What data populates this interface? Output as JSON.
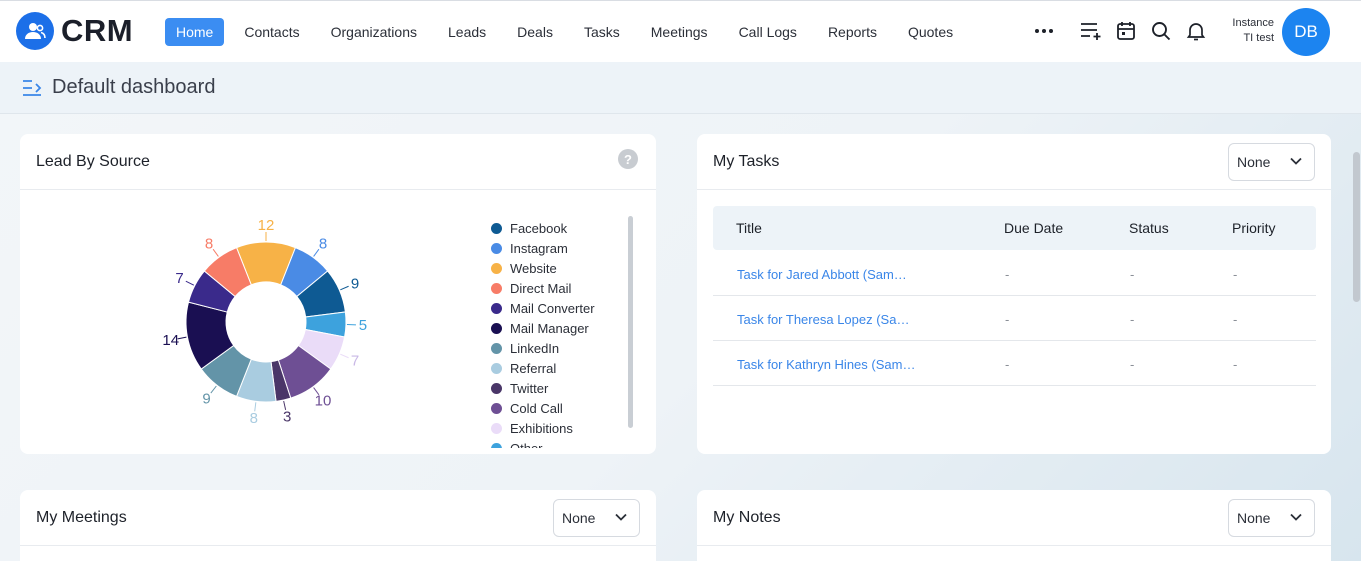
{
  "app": {
    "name": "CRM"
  },
  "nav": {
    "items": [
      "Home",
      "Contacts",
      "Organizations",
      "Leads",
      "Deals",
      "Tasks",
      "Meetings",
      "Call Logs",
      "Reports",
      "Quotes"
    ],
    "more_icon": "more-horizontal-icon",
    "icons": [
      "add-list-icon",
      "calendar-icon",
      "search-icon",
      "bell-icon"
    ]
  },
  "user": {
    "instance_line1": "Instance",
    "instance_line2": "TI test",
    "initials": "DB"
  },
  "dashboard": {
    "title": "Default dashboard"
  },
  "lead_by_source": {
    "title": "Lead By Source",
    "help": "?",
    "chart_data": {
      "type": "pie",
      "title": "Lead By Source",
      "donut": true,
      "categories": [
        "Facebook",
        "Instagram",
        "Website",
        "Direct Mail",
        "Mail Converter",
        "Mail Manager",
        "LinkedIn",
        "Referral",
        "Twitter",
        "Cold Call",
        "Exhibitions",
        "Other"
      ],
      "values": [
        9,
        8,
        12,
        8,
        7,
        14,
        9,
        8,
        3,
        10,
        7,
        5
      ],
      "colors": [
        "#0e5a93",
        "#4a8be5",
        "#f7b247",
        "#f77c67",
        "#3a2a8b",
        "#1a0f52",
        "#6394a8",
        "#a9cce0",
        "#4a3668",
        "#6e4f94",
        "#eadcf8",
        "#3da2dd"
      ],
      "legend": "right"
    }
  },
  "my_tasks": {
    "title": "My Tasks",
    "filter": "None",
    "columns": [
      "Title",
      "Due Date",
      "Status",
      "Priority"
    ],
    "rows": [
      {
        "title": "Task for Jared Abbott (Sam…",
        "due": "-",
        "status": "-",
        "priority": "-"
      },
      {
        "title": "Task for Theresa Lopez (Sa…",
        "due": "-",
        "status": "-",
        "priority": "-"
      },
      {
        "title": "Task for Kathryn Hines (Sam…",
        "due": "-",
        "status": "-",
        "priority": "-"
      }
    ]
  },
  "my_meetings": {
    "title": "My Meetings",
    "filter": "None"
  },
  "my_notes": {
    "title": "My Notes",
    "filter": "None"
  }
}
